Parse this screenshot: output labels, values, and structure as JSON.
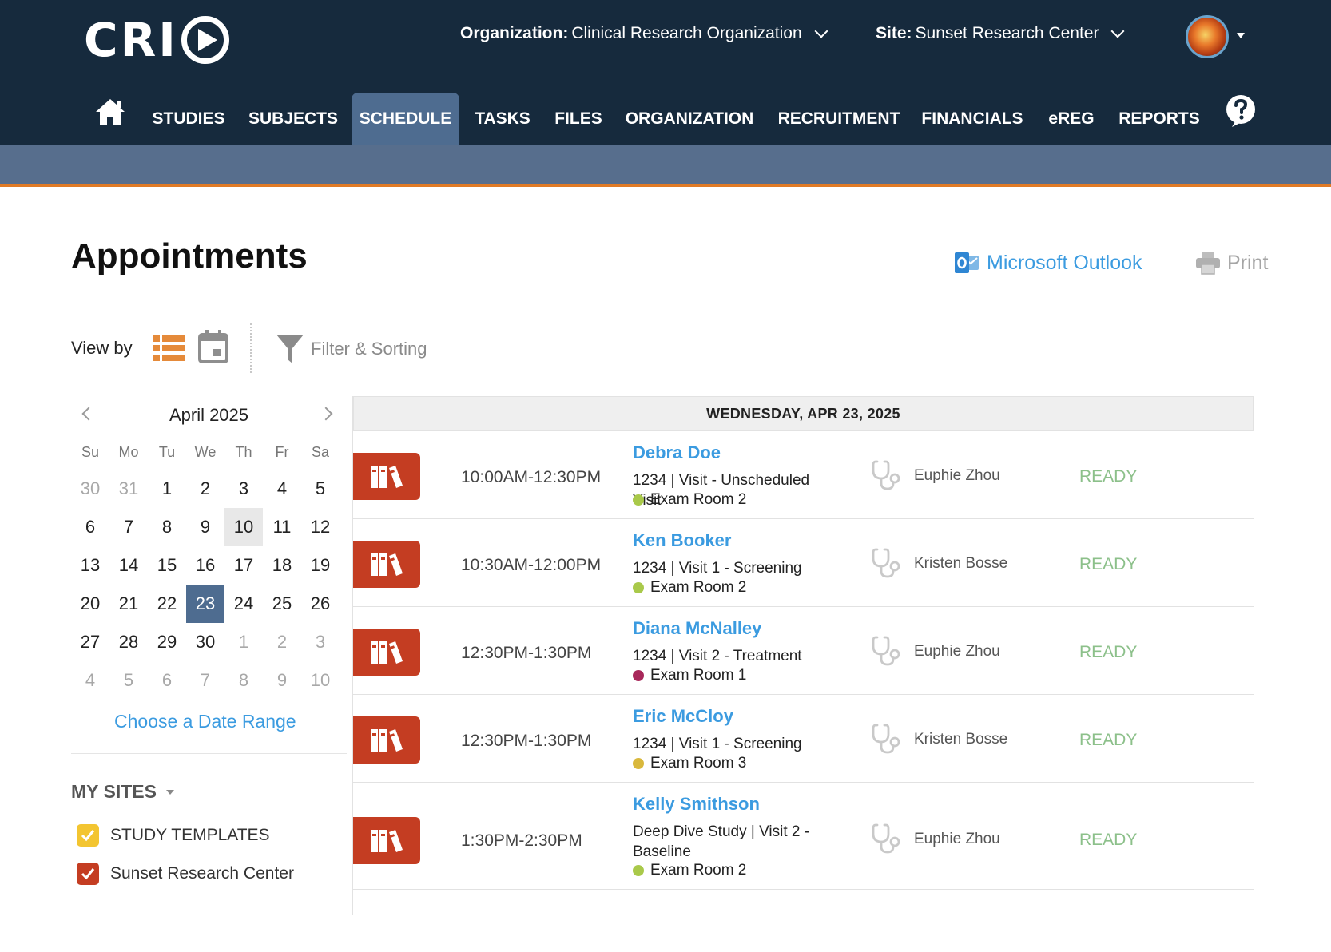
{
  "header": {
    "logo_text": "CRI",
    "organization_label": "Organization:",
    "organization_value": "Clinical Research Organization",
    "site_label": "Site:",
    "site_value": "Sunset Research Center"
  },
  "nav": {
    "items": [
      "STUDIES",
      "SUBJECTS",
      "SCHEDULE",
      "TASKS",
      "FILES",
      "ORGANIZATION",
      "RECRUITMENT",
      "FINANCIALS",
      "eREG",
      "REPORTS"
    ],
    "active": "SCHEDULE"
  },
  "page": {
    "title": "Appointments",
    "outlook_label": "Microsoft Outlook",
    "print_label": "Print",
    "viewby_label": "View by",
    "filter_label": "Filter & Sorting"
  },
  "calendar": {
    "month_label": "April 2025",
    "dow": [
      "Su",
      "Mo",
      "Tu",
      "We",
      "Th",
      "Fr",
      "Sa"
    ],
    "days": [
      {
        "d": "30",
        "m": true
      },
      {
        "d": "31",
        "m": true
      },
      {
        "d": "1"
      },
      {
        "d": "2"
      },
      {
        "d": "3"
      },
      {
        "d": "4"
      },
      {
        "d": "5"
      },
      {
        "d": "6"
      },
      {
        "d": "7"
      },
      {
        "d": "8"
      },
      {
        "d": "9"
      },
      {
        "d": "10",
        "today": true
      },
      {
        "d": "11"
      },
      {
        "d": "12"
      },
      {
        "d": "13"
      },
      {
        "d": "14"
      },
      {
        "d": "15"
      },
      {
        "d": "16"
      },
      {
        "d": "17"
      },
      {
        "d": "18"
      },
      {
        "d": "19"
      },
      {
        "d": "20"
      },
      {
        "d": "21"
      },
      {
        "d": "22"
      },
      {
        "d": "23",
        "selected": true
      },
      {
        "d": "24"
      },
      {
        "d": "25"
      },
      {
        "d": "26"
      },
      {
        "d": "27"
      },
      {
        "d": "28"
      },
      {
        "d": "29"
      },
      {
        "d": "30"
      },
      {
        "d": "1",
        "m": true
      },
      {
        "d": "2",
        "m": true
      },
      {
        "d": "3",
        "m": true
      },
      {
        "d": "4",
        "m": true
      },
      {
        "d": "5",
        "m": true
      },
      {
        "d": "6",
        "m": true
      },
      {
        "d": "7",
        "m": true
      },
      {
        "d": "8",
        "m": true
      },
      {
        "d": "9",
        "m": true
      },
      {
        "d": "10",
        "m": true
      }
    ],
    "date_range_label": "Choose a Date Range"
  },
  "sites": {
    "heading": "MY SITES",
    "items": [
      {
        "label": "STUDY TEMPLATES",
        "color": "#f3c531",
        "checked": true
      },
      {
        "label": "Sunset Research Center",
        "color": "#c43d22",
        "checked": true
      }
    ]
  },
  "schedule": {
    "day_header": "WEDNESDAY, APR 23, 2025",
    "appointments": [
      {
        "time": "10:00AM-12:30PM",
        "name": "Debra Doe",
        "visit": "1234 | Visit - Unscheduled Visit",
        "room": "Exam Room 2",
        "room_color": "#a9c94a",
        "provider": "Euphie Zhou",
        "status": "READY"
      },
      {
        "time": "10:30AM-12:00PM",
        "name": "Ken Booker",
        "visit": "1234 | Visit 1 - Screening",
        "room": "Exam Room 2",
        "room_color": "#a9c94a",
        "provider": "Kristen Bosse",
        "status": "READY"
      },
      {
        "time": "12:30PM-1:30PM",
        "name": "Diana McNalley",
        "visit": "1234 | Visit 2 - Treatment",
        "room": "Exam Room 1",
        "room_color": "#a8285a",
        "provider": "Euphie Zhou",
        "status": "READY"
      },
      {
        "time": "12:30PM-1:30PM",
        "name": "Eric McCloy",
        "visit": "1234 | Visit 1 - Screening",
        "room": "Exam Room 3",
        "room_color": "#d9b83c",
        "provider": "Kristen Bosse",
        "status": "READY"
      },
      {
        "time": "1:30PM-2:30PM",
        "name": "Kelly Smithson",
        "visit": "Deep Dive Study | Visit 2 - Baseline",
        "room": "Exam Room 2",
        "room_color": "#a9c94a",
        "provider": "Euphie Zhou",
        "status": "READY"
      }
    ]
  },
  "colors": {
    "header_bg": "#162a3d",
    "nav_active": "#4e6c90",
    "subbar": "#576e8d",
    "accent_orange": "#e07a25",
    "link_blue": "#3b9be0",
    "binder_red": "#c43d22",
    "status_green": "#8cc08a"
  }
}
